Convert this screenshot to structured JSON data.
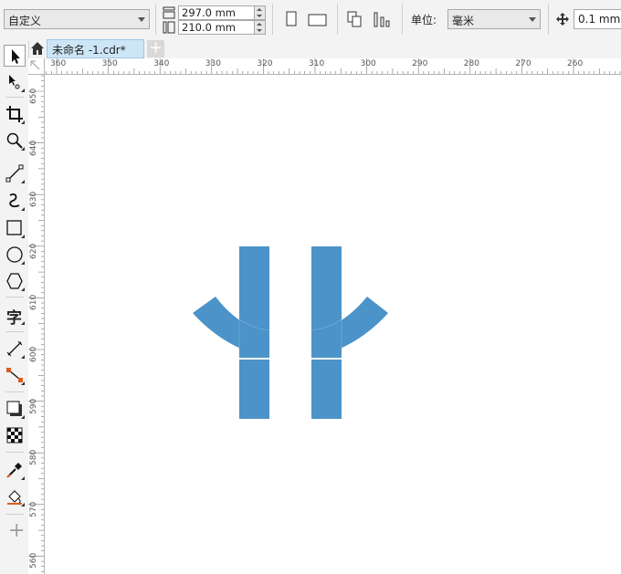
{
  "propbar": {
    "page_preset": "自定义",
    "width_value": "297.0 mm",
    "height_value": "210.0 mm",
    "units_label": "单位:",
    "units_value": "毫米",
    "nudge_value": "0.1 mm"
  },
  "tabs": {
    "doc_title": "未命名 -1.cdr*",
    "new_tab": "+"
  },
  "toolbox": {
    "tools": [
      "pick-tool-icon",
      "shape-tool-icon",
      "crop-tool-icon",
      "zoom-tool-icon",
      "freehand-tool-icon",
      "artistic-media-icon",
      "rectangle-tool-icon",
      "ellipse-tool-icon",
      "polygon-tool-icon",
      "text-tool-icon",
      "parallel-dimension-icon",
      "connector-tool-icon",
      "drop-shadow-icon",
      "transparency-icon",
      "color-eyedropper-icon",
      "interactive-fill-icon",
      "add-tool-icon"
    ],
    "text_tool_glyph": "字",
    "add_glyph": "+"
  },
  "rulers": {
    "h_labels": [
      "360",
      "350",
      "340",
      "330",
      "320",
      "310",
      "300",
      "290",
      "280",
      "270",
      "260"
    ],
    "v_labels": [
      "650",
      "640",
      "630",
      "620",
      "610",
      "600",
      "590",
      "580",
      "570",
      "560"
    ]
  },
  "colors": {
    "shape_fill": "#4b93c8",
    "tab_active": "#cde6f7"
  }
}
